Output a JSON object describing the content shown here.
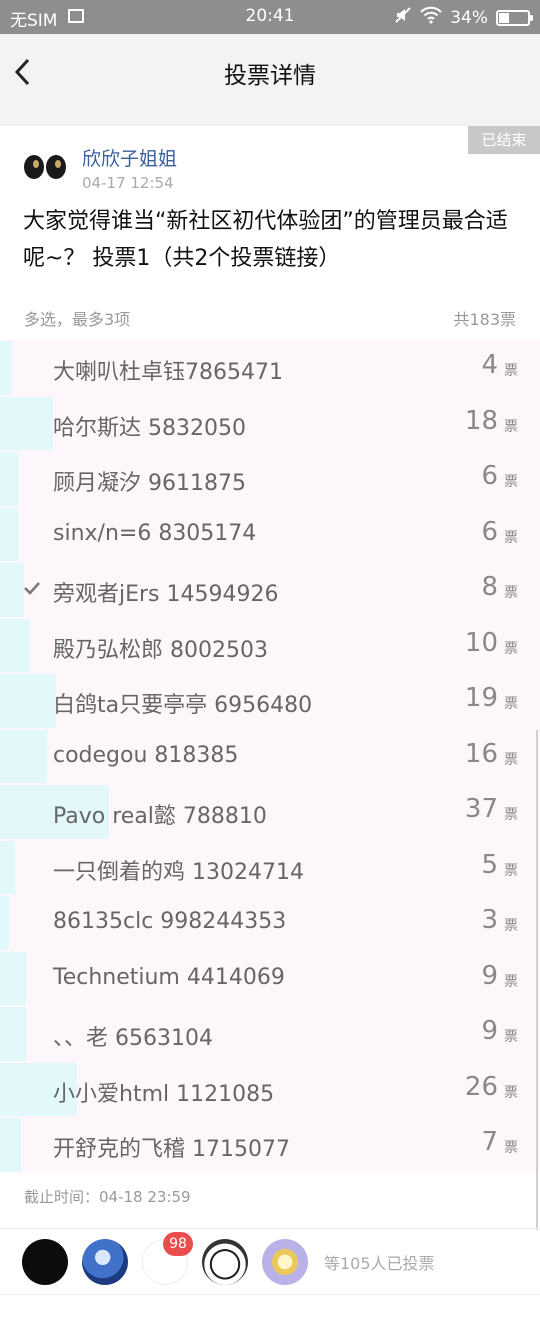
{
  "status_bar": {
    "carrier": "无SIM",
    "time": "20:41",
    "battery": "34%",
    "battery_level": 0.34
  },
  "header": {
    "title": "投票详情"
  },
  "poll": {
    "status_badge": "已结束",
    "author": {
      "name": "欣欣子姐姐",
      "time": "04-17 12:54"
    },
    "question": "大家觉得谁当“新社区初代体验团”的管理员最合适呢~？ 投票1（共2个投票链接）",
    "selection_rule": "多选，最多3项",
    "total_votes": "共183票",
    "vote_unit": "票",
    "options": [
      {
        "label": "大喇叭杜卓钰7865471",
        "count": "4",
        "share": 0.022,
        "checked": false
      },
      {
        "label": "哈尔斯达 5832050",
        "count": "18",
        "share": 0.098,
        "checked": false
      },
      {
        "label": "顾月凝汐 9611875",
        "count": "6",
        "share": 0.033,
        "checked": false
      },
      {
        "label": "sinx/n=6 8305174",
        "count": "6",
        "share": 0.033,
        "checked": false
      },
      {
        "label": "旁观者jErs 14594926",
        "count": "8",
        "share": 0.044,
        "checked": true
      },
      {
        "label": "殿乃弘松郎 8002503",
        "count": "10",
        "share": 0.055,
        "checked": false
      },
      {
        "label": "白鸽ta只要亭亭 6956480",
        "count": "19",
        "share": 0.104,
        "checked": false
      },
      {
        "label": "codegou 818385",
        "count": "16",
        "share": 0.087,
        "checked": false
      },
      {
        "label": "Pavo real懿 788810",
        "count": "37",
        "share": 0.202,
        "checked": false
      },
      {
        "label": "一只倒着的鸡 13024714",
        "count": "5",
        "share": 0.027,
        "checked": false
      },
      {
        "label": "86135clc 998244353",
        "count": "3",
        "share": 0.016,
        "checked": false
      },
      {
        "label": "Technetium 4414069",
        "count": "9",
        "share": 0.049,
        "checked": false
      },
      {
        "label": "、、老 6563104",
        "count": "9",
        "share": 0.049,
        "checked": false
      },
      {
        "label": "小小爱html 1121085",
        "count": "26",
        "share": 0.142,
        "checked": false
      },
      {
        "label": "开舒克的飞稽 1715077",
        "count": "7",
        "share": 0.038,
        "checked": false
      }
    ],
    "deadline": "截止时间：04-18 23:59",
    "voters": {
      "badge_count": "98",
      "summary": "等105人已投票"
    }
  },
  "colors": {
    "bar_fill": "#e2f8fb",
    "row_bg": "#fdf7fc",
    "author_name": "#3a5f9f",
    "badge_bg": "#e94d4d"
  }
}
